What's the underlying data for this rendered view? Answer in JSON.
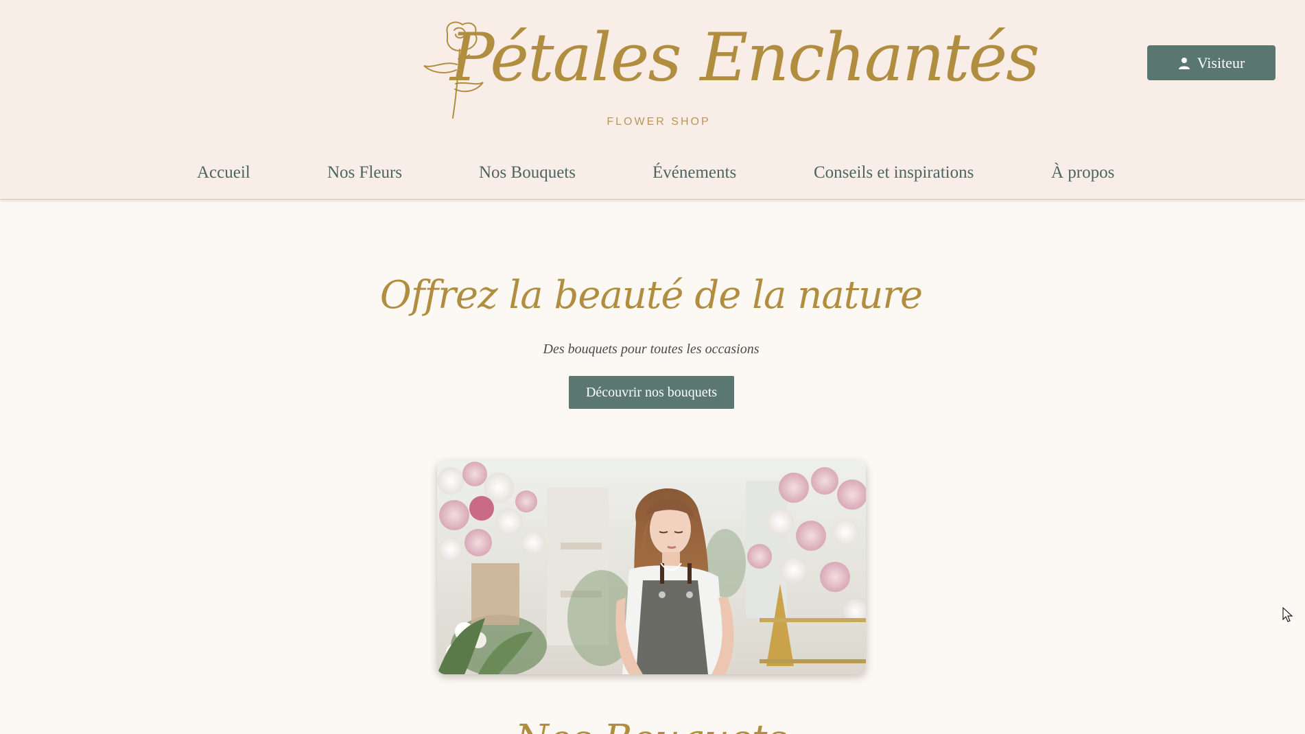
{
  "brand": {
    "name": "Pétales Enchantés",
    "tagline": "FLOWER SHOP",
    "logo_icon": "rose-icon",
    "color": "#b08d3f"
  },
  "account": {
    "label": "Visiteur",
    "icon": "user-icon"
  },
  "nav": {
    "items": [
      {
        "label": "Accueil"
      },
      {
        "label": "Nos Fleurs"
      },
      {
        "label": "Nos Bouquets"
      },
      {
        "label": "Événements"
      },
      {
        "label": "Conseils et inspirations"
      },
      {
        "label": "À propos"
      }
    ]
  },
  "hero": {
    "title": "Offrez la beauté de la nature",
    "subtitle": "Des bouquets pour toutes les occasions",
    "cta": "Découvrir nos bouquets",
    "image_subject": "florist-at-work-photo"
  },
  "next_section": {
    "heading": "Nos Bouquets"
  },
  "colors": {
    "header_bg": "#f8ede7",
    "page_bg": "#fcf9f5",
    "accent_gold": "#b08d3f",
    "button_green": "#5a7771",
    "nav_text": "#4c655e"
  }
}
